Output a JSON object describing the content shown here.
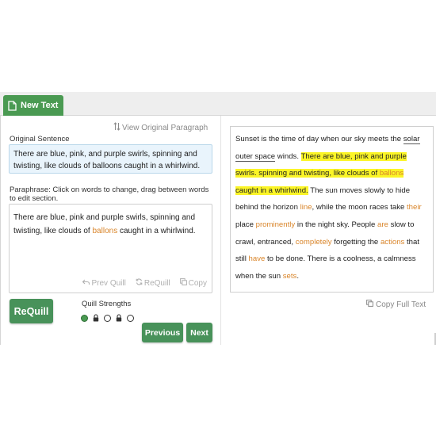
{
  "tab": {
    "label": "New Text"
  },
  "left": {
    "view_original": "View Original Paragraph",
    "original_label": "Original Sentence",
    "original_text": "There are blue, pink, and purple swirls, spinning and twisting, like clouds of balloons caught in a whirlwind.",
    "paraphrase_label": "Paraphrase: Click on words to change, drag between words to edit section.",
    "paraphrase": {
      "before": "There are blue, pink and purple swirls, spinning and twisting, like clouds of ",
      "changed": "ballons",
      "after": " caught in a whirlwind."
    },
    "actions": {
      "prev": "Prev Quill",
      "requill": "ReQuill",
      "copy": "Copy"
    },
    "requill_button": "ReQuill",
    "strength_label": "Quill Strengths",
    "strength_levels": 5,
    "strength_selected": 1,
    "previous_button": "Previous",
    "next_button": "Next"
  },
  "right": {
    "copy_full": "Copy Full Text",
    "segments": [
      {
        "t": "Sunset is the time of day when our sky meets the "
      },
      {
        "t": "solar outer space",
        "style": "underline"
      },
      {
        "t": " winds. "
      },
      {
        "t": "There are blue, pink and purple swirls. spinning and twisting, like clouds of ",
        "style": "hl"
      },
      {
        "t": "ballons",
        "style": "hl-orange"
      },
      {
        "t": " caught in a whirlwind.",
        "style": "hl"
      },
      {
        "t": " The sun moves slowly to hide behind the horizon "
      },
      {
        "t": "line",
        "style": "orange"
      },
      {
        "t": ", while the moon races take "
      },
      {
        "t": "their",
        "style": "orange"
      },
      {
        "t": " place "
      },
      {
        "t": "prominently",
        "style": "orange"
      },
      {
        "t": " in the night sky. People "
      },
      {
        "t": "are",
        "style": "orange"
      },
      {
        "t": " slow to crawl, entranced, "
      },
      {
        "t": "completely",
        "style": "orange"
      },
      {
        "t": " forgetting the "
      },
      {
        "t": "actions",
        "style": "orange"
      },
      {
        "t": " that still "
      },
      {
        "t": "have",
        "style": "orange"
      },
      {
        "t": " to be done. There is a coolness, a calmness when the sun "
      },
      {
        "t": "sets",
        "style": "orange"
      },
      {
        "t": "."
      }
    ]
  },
  "colors": {
    "accent": "#4a9a52",
    "highlight": "#fbf527",
    "changed": "#d9852a"
  }
}
